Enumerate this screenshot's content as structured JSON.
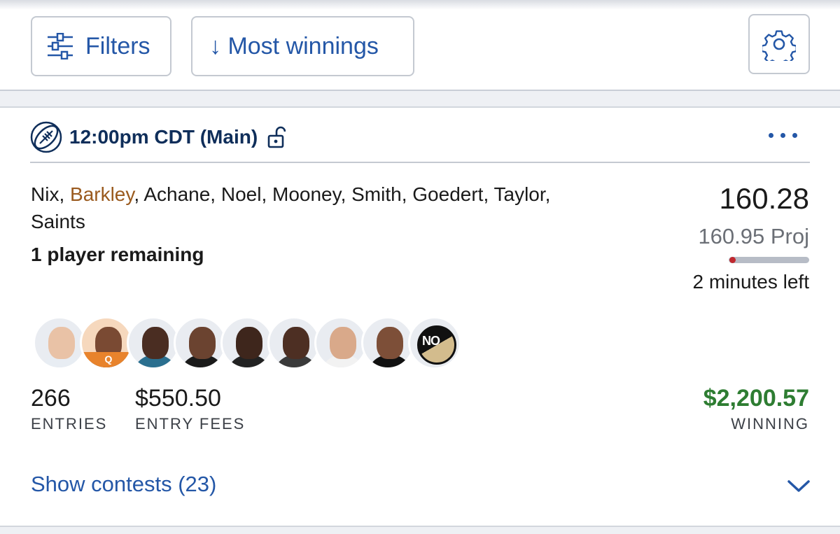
{
  "toolbar": {
    "filters_label": "Filters",
    "sort_label": "↓ Most winnings",
    "filters_icon": "sliders-icon",
    "settings_icon": "gear-icon"
  },
  "slate": {
    "title": "12:00pm CDT (Main)",
    "sport_icon": "football-icon",
    "lock_icon": "unlocked-icon",
    "more_icon": "more-dots-icon"
  },
  "lineup": {
    "players": [
      "Nix",
      "Barkley",
      "Achane",
      "Noel",
      "Mooney",
      "Smith",
      "Goedert",
      "Taylor",
      "Saints"
    ],
    "highlighted_player": "Barkley",
    "remaining": "1 player remaining",
    "score": "160.28",
    "projection": "160.95 Proj",
    "time_progress": 0.02,
    "time_left": "2 minutes left"
  },
  "avatars": [
    {
      "name": "Nix",
      "badge": ""
    },
    {
      "name": "Barkley",
      "badge": "Q"
    },
    {
      "name": "Achane",
      "badge": ""
    },
    {
      "name": "Noel",
      "badge": ""
    },
    {
      "name": "Mooney",
      "badge": ""
    },
    {
      "name": "Smith",
      "badge": ""
    },
    {
      "name": "Goedert",
      "badge": ""
    },
    {
      "name": "Taylor",
      "badge": ""
    },
    {
      "name": "Saints",
      "badge": "",
      "logo_text": "NO"
    }
  ],
  "stats": {
    "entries_value": "266",
    "entries_label": "ENTRIES",
    "fees_value": "$550.50",
    "fees_label": "ENTRY FEES",
    "winning_value": "$2,200.57",
    "winning_label": "WINNING"
  },
  "footer": {
    "show_contests": "Show contests (23)",
    "chevron_icon": "chevron-down-icon"
  },
  "colors": {
    "accent": "#2457a7",
    "winning": "#2e7d32",
    "highlight_player": "#9a5a1e",
    "questionable_badge": "#e8832c",
    "progress_fill": "#c0282e"
  }
}
